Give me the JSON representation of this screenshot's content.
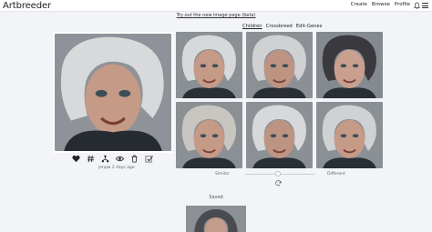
{
  "header": {
    "logo": "Artbreeder",
    "nav": [
      "Create",
      "Browse",
      "Profile"
    ],
    "icons": [
      "bell-icon",
      "hamburger-menu-icon"
    ]
  },
  "beta_link": "Try out the new image page (beta)",
  "tabs": [
    {
      "label": "Children",
      "active": true
    },
    {
      "label": "Crossbreed",
      "active": false
    },
    {
      "label": "Edit-Genes",
      "active": false
    }
  ],
  "main_image": {
    "owner": "jenpw",
    "time": "2 days ago",
    "action_icons": [
      "heart-icon",
      "hash-icon",
      "tree-icon",
      "eye-icon",
      "trash-icon",
      "checkmark-icon"
    ]
  },
  "children": {
    "count": 6,
    "slider": {
      "left_label": "Similar",
      "right_label": "Different",
      "value": 0.5
    },
    "refresh_icon": "refresh-icon"
  },
  "saved": {
    "label": "Saved"
  }
}
